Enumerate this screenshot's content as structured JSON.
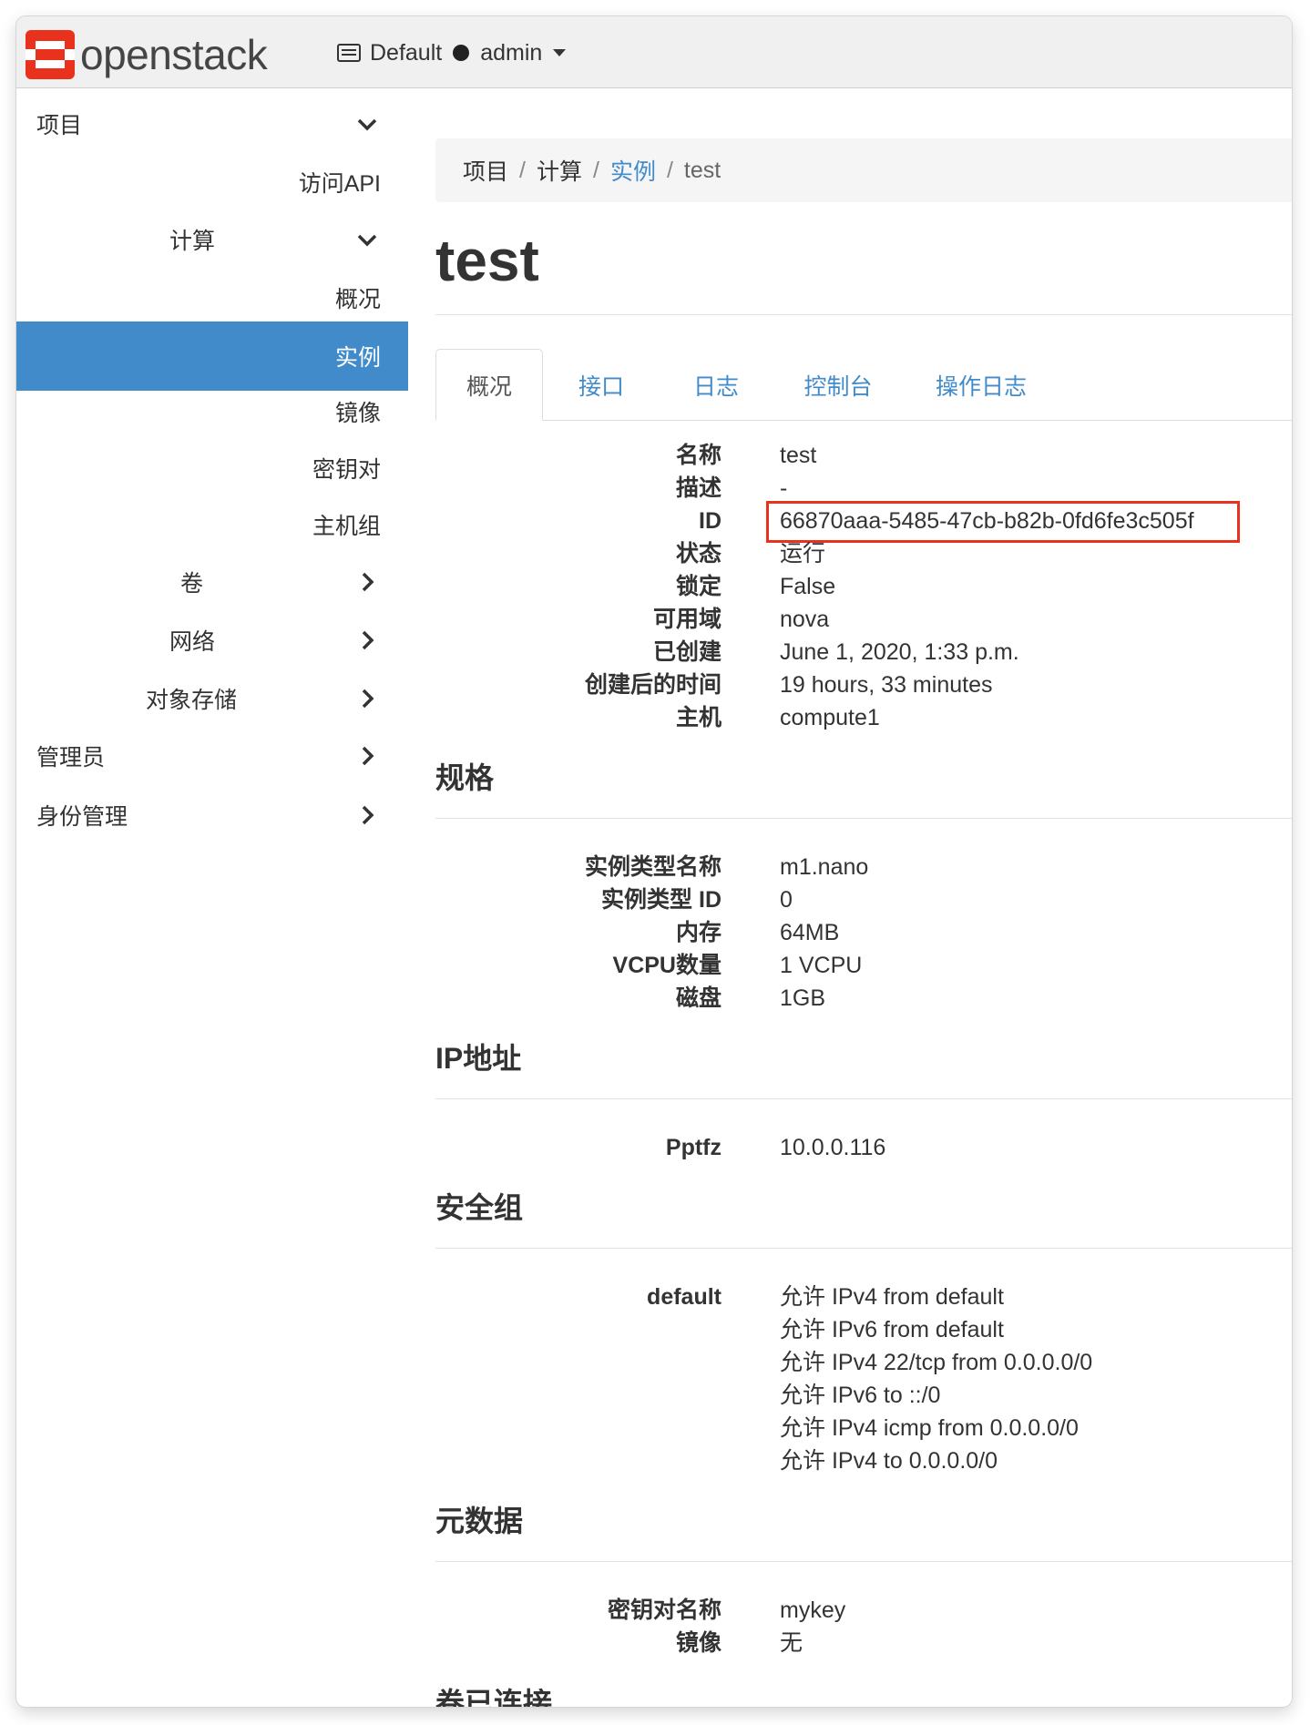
{
  "navbar": {
    "brand": "openstack",
    "domain": "Default",
    "user": "admin",
    "accent_color": "#e8321e"
  },
  "sidebar": {
    "items": [
      {
        "label": "项目",
        "icon": "chevron-down-icon"
      },
      {
        "label": "访问API"
      },
      {
        "label": "计算",
        "icon": "chevron-down-icon"
      },
      {
        "label": "概况"
      },
      {
        "label": "实例",
        "active": true
      },
      {
        "label": "镜像"
      },
      {
        "label": "密钥对"
      },
      {
        "label": "主机组"
      },
      {
        "label": "卷",
        "icon": "chevron-right-icon"
      },
      {
        "label": "网络",
        "icon": "chevron-right-icon"
      },
      {
        "label": "对象存储",
        "icon": "chevron-right-icon"
      },
      {
        "label": "管理员",
        "icon": "chevron-right-icon"
      },
      {
        "label": "身份管理",
        "icon": "chevron-right-icon"
      }
    ],
    "active_color": "#428bca"
  },
  "breadcrumb": [
    "项目",
    "计算",
    "实例",
    "test"
  ],
  "page_title": "test",
  "tabs": [
    "概况",
    "接口",
    "日志",
    "控制台",
    "操作日志"
  ],
  "overview": [
    {
      "label": "名称",
      "value": "test"
    },
    {
      "label": "描述",
      "value": "-"
    },
    {
      "label": "ID",
      "value": "66870aaa-5485-47cb-b82b-0fd6fe3c505f"
    },
    {
      "label": "状态",
      "value": "运行"
    },
    {
      "label": "锁定",
      "value": "False"
    },
    {
      "label": "可用域",
      "value": "nova"
    },
    {
      "label": "已创建",
      "value": "June 1, 2020, 1:33 p.m."
    },
    {
      "label": "创建后的时间",
      "value": "19 hours, 33 minutes"
    },
    {
      "label": "主机",
      "value": "compute1"
    }
  ],
  "spec": {
    "title": "规格",
    "rows": [
      {
        "label": "实例类型名称",
        "value": "m1.nano"
      },
      {
        "label": "实例类型 ID",
        "value": "0"
      },
      {
        "label": "内存",
        "value": "64MB"
      },
      {
        "label": "VCPU数量",
        "value": "1 VCPU"
      },
      {
        "label": "磁盘",
        "value": "1GB"
      }
    ]
  },
  "ip": {
    "title": "IP地址",
    "rows": [
      {
        "label": "Pptfz",
        "value": "10.0.0.116"
      }
    ]
  },
  "security": {
    "title": "安全组",
    "label": "default",
    "rules": [
      "允许 IPv4 from default",
      "允许 IPv6 from default",
      "允许 IPv4 22/tcp from 0.0.0.0/0",
      "允许 IPv6 to ::/0",
      "允许 IPv4 icmp from 0.0.0.0/0",
      "允许 IPv4 to 0.0.0.0/0"
    ]
  },
  "metadata": {
    "title": "元数据",
    "rows": [
      {
        "label": "密钥对名称",
        "value": "mykey"
      },
      {
        "label": "镜像",
        "value": "无"
      }
    ]
  },
  "volumes": {
    "title": "卷已连接"
  }
}
